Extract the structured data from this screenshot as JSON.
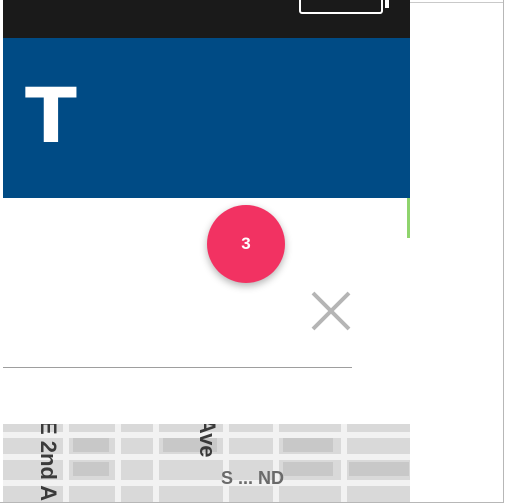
{
  "app_bar": {
    "title_fragment": "T",
    "color": "#004b85"
  },
  "badge": {
    "count": "3",
    "color": "#f23262"
  },
  "close_button": {
    "icon": "close-icon"
  },
  "map": {
    "street_labels": [
      "E 2nd A",
      "Ave",
      "S ... ND"
    ]
  },
  "status_bar": {
    "battery_icon": "battery-icon"
  }
}
